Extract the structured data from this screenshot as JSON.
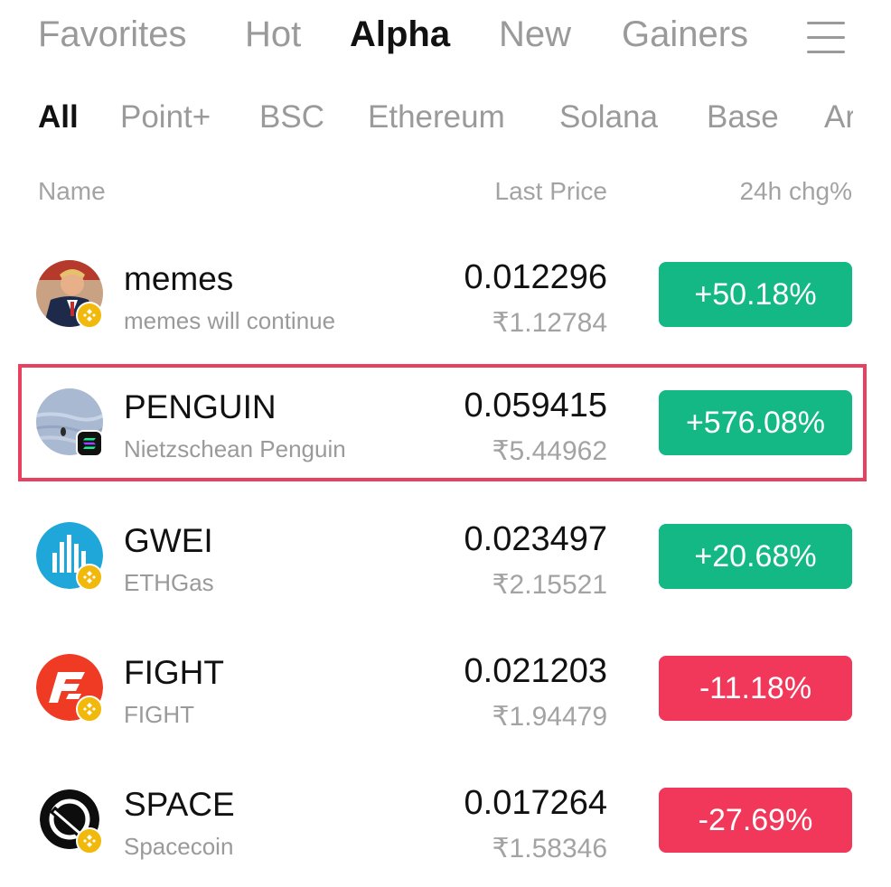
{
  "tabs": [
    "Favorites",
    "Hot",
    "Alpha",
    "New",
    "Gainers"
  ],
  "active_tab": "Alpha",
  "chains": [
    "All",
    "Point+",
    "BSC",
    "Ethereum",
    "Solana",
    "Base",
    "Ar"
  ],
  "active_chain": "All",
  "columns": {
    "name": "Name",
    "price": "Last Price",
    "change": "24h chg%"
  },
  "colors": {
    "up": "#14b885",
    "down": "#f2385a",
    "highlight": "#e8415f",
    "bnb_badge": "#f0b90b"
  },
  "rows": [
    {
      "symbol": "memes",
      "name": "memes will continue",
      "price": "0.012296",
      "fiat": "₹1.12784",
      "change": "+50.18%",
      "direction": "up",
      "badge": "bnb-icon",
      "icon": "memes-avatar-icon",
      "highlighted": false
    },
    {
      "symbol": "PENGUIN",
      "name": "Nietzschean Penguin",
      "price": "0.059415",
      "fiat": "₹5.44962",
      "change": "+576.08%",
      "direction": "up",
      "badge": "solana-icon",
      "icon": "penguin-avatar-icon",
      "highlighted": true
    },
    {
      "symbol": "GWEI",
      "name": "ETHGas",
      "price": "0.023497",
      "fiat": "₹2.15521",
      "change": "+20.68%",
      "direction": "up",
      "badge": "bnb-icon",
      "icon": "gwei-logo-icon",
      "highlighted": false
    },
    {
      "symbol": "FIGHT",
      "name": "FIGHT",
      "price": "0.021203",
      "fiat": "₹1.94479",
      "change": "-11.18%",
      "direction": "down",
      "badge": "bnb-icon",
      "icon": "fight-logo-icon",
      "highlighted": false
    },
    {
      "symbol": "SPACE",
      "name": "Spacecoin",
      "price": "0.017264",
      "fiat": "₹1.58346",
      "change": "-27.69%",
      "direction": "down",
      "badge": "bnb-icon",
      "icon": "space-logo-icon",
      "highlighted": false
    }
  ]
}
